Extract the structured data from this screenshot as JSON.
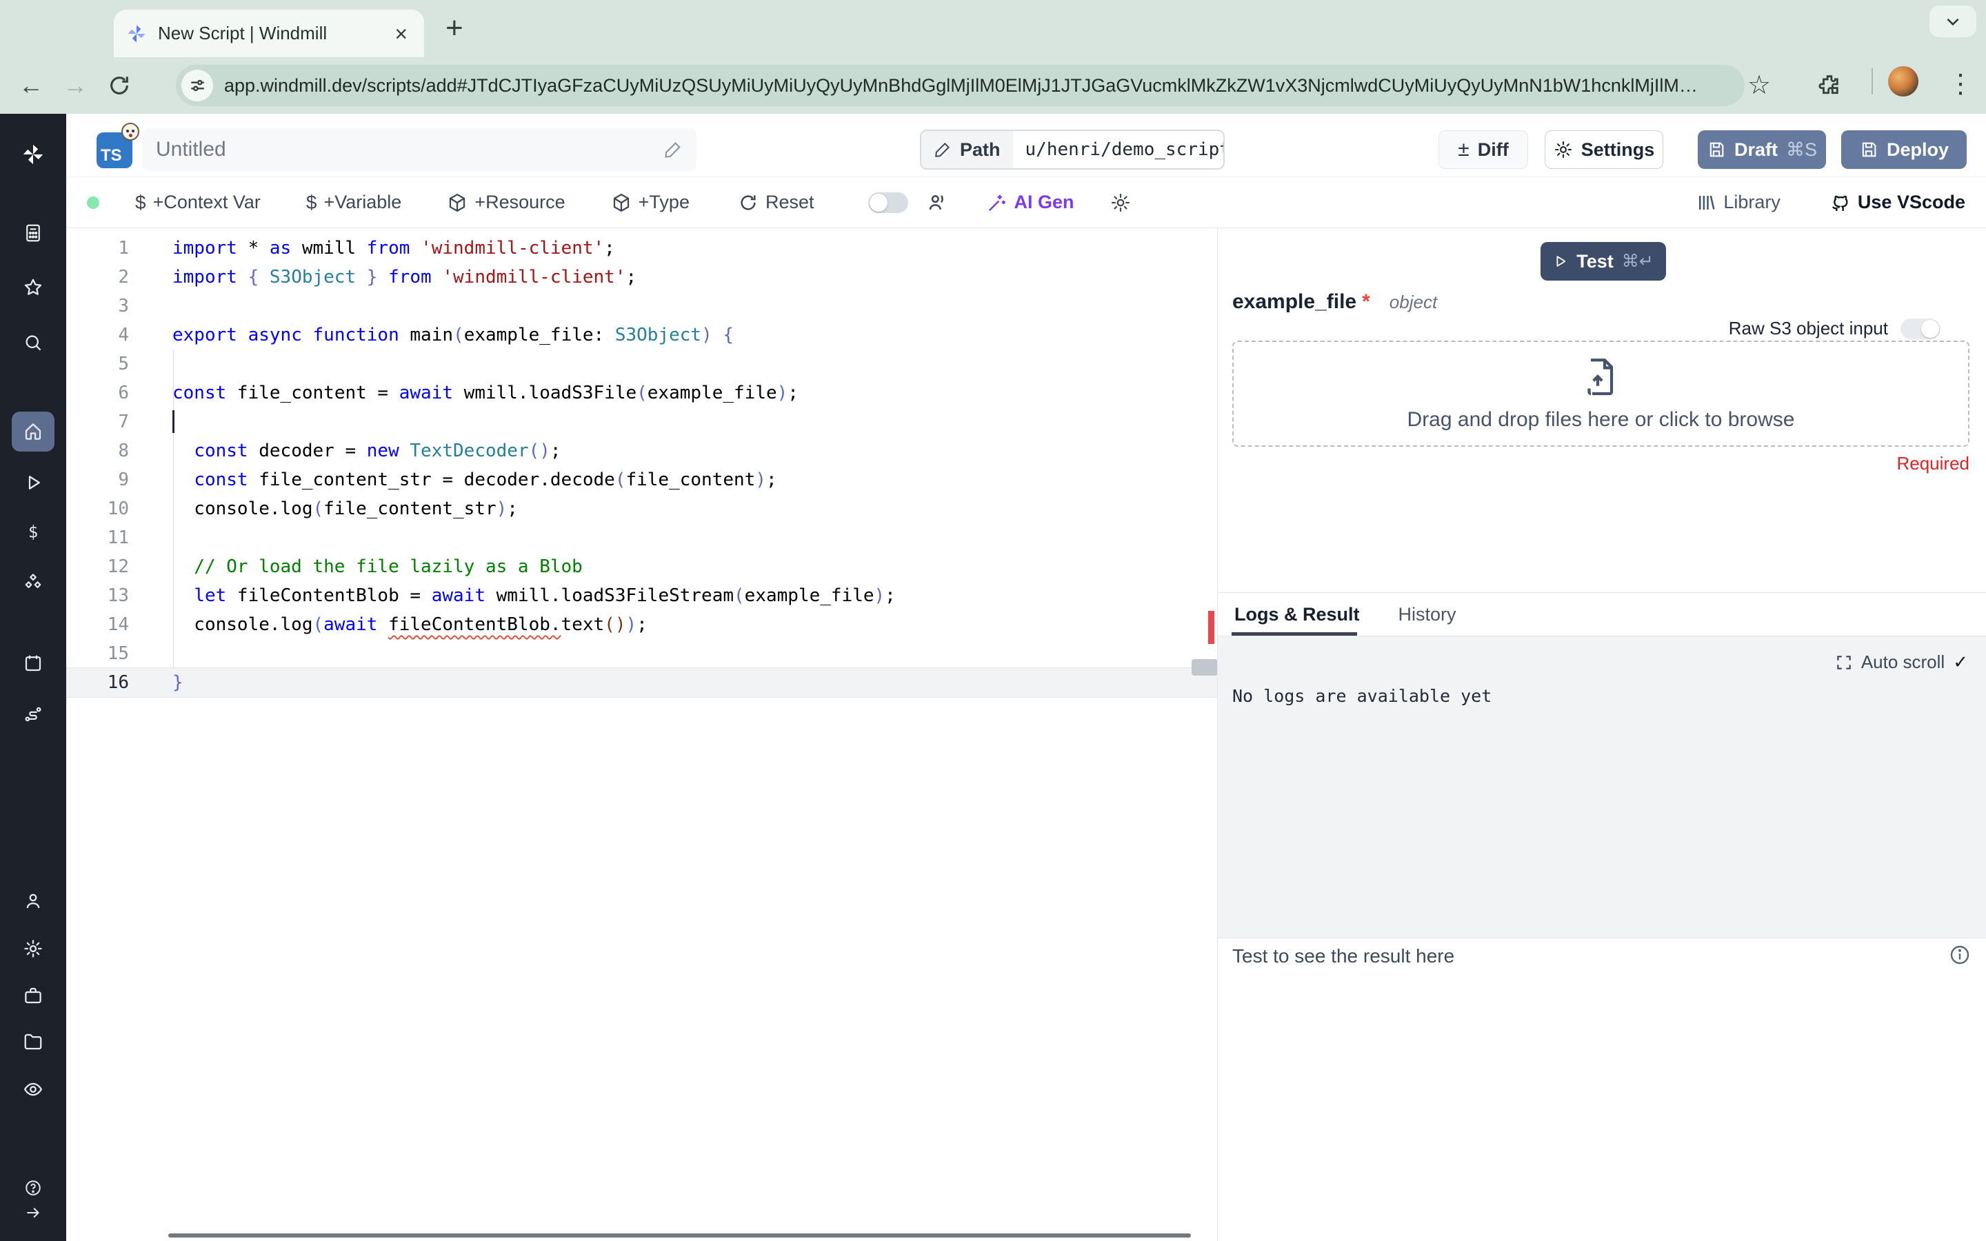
{
  "browser": {
    "tab_title": "New Script | Windmill",
    "close_tab_label": "×",
    "new_tab_label": "+",
    "back_label": "←",
    "forward_label": "→",
    "url": "app.windmill.dev/scripts/add#JTdCJTIyaGFzaCUyMiUzQSUyMiUyMiUyQyUyMnBhdGglMjIlM0ElMjJ1JTJGaGVucmklMkZkZW1vX3NjcmlwdCUyMiUyQyUyMnN1bW1hcnklMjIlM0ElMjIlMjIlMkMlMjJjb250ZW50JTIy",
    "menu_dots": "⋮",
    "bookmark_star": "☆"
  },
  "header": {
    "file_icon_label": "TS",
    "script_name": "Untitled",
    "path_label": "Path",
    "path_value": "u/henri/demo_script",
    "diff_label": "Diff",
    "diff_plusminus": "±",
    "settings_label": "Settings",
    "draft_label": "Draft",
    "draft_shortcut": "⌘S",
    "deploy_label": "Deploy"
  },
  "toolbar": {
    "context_var_label": "+Context Var",
    "variable_label": "+Variable",
    "resource_label": "+Resource",
    "type_label": "+Type",
    "reset_label": "Reset",
    "ai_gen_label": "AI Gen",
    "library_label": "Library",
    "vscode_label": "Use VScode",
    "dollar_glyph": "$"
  },
  "sidebar": {
    "icons_top": [
      "windmill-logo",
      "apps",
      "star",
      "search"
    ],
    "icons_mid": [
      "home",
      "runs",
      "variables",
      "resources",
      "schedules",
      "flows"
    ],
    "active_item": "home",
    "icons_bottom": [
      "user",
      "settings",
      "workers",
      "folders",
      "audit-logs"
    ],
    "icons_footer": [
      "help",
      "collapse-arrow"
    ]
  },
  "editor": {
    "lines": [
      {
        "n": 1,
        "tokens": [
          [
            "k",
            "import"
          ],
          [
            "p",
            " * "
          ],
          [
            "k",
            "as"
          ],
          [
            "p",
            " wmill "
          ],
          [
            "k",
            "from"
          ],
          [
            "p",
            " "
          ],
          [
            "s",
            "'windmill-client'"
          ],
          [
            "p",
            ";"
          ]
        ]
      },
      {
        "n": 2,
        "tokens": [
          [
            "k",
            "import"
          ],
          [
            "p",
            " "
          ],
          [
            "b",
            "{"
          ],
          [
            "p",
            " "
          ],
          [
            "t",
            "S3Object"
          ],
          [
            "p",
            " "
          ],
          [
            "b",
            "}"
          ],
          [
            "p",
            " "
          ],
          [
            "k",
            "from"
          ],
          [
            "p",
            " "
          ],
          [
            "s",
            "'windmill-client'"
          ],
          [
            "p",
            ";"
          ]
        ]
      },
      {
        "n": 3,
        "tokens": []
      },
      {
        "n": 4,
        "tokens": [
          [
            "k",
            "export"
          ],
          [
            "p",
            " "
          ],
          [
            "k",
            "async"
          ],
          [
            "p",
            " "
          ],
          [
            "k",
            "function"
          ],
          [
            "p",
            " main"
          ],
          [
            "b",
            "("
          ],
          [
            "p",
            "example_file: "
          ],
          [
            "t",
            "S3Object"
          ],
          [
            "b",
            ")"
          ],
          [
            "p",
            " "
          ],
          [
            "b",
            "{"
          ]
        ]
      },
      {
        "n": 5,
        "tokens": []
      },
      {
        "n": 6,
        "tokens": [
          [
            "k",
            "const"
          ],
          [
            "p",
            " file_content = "
          ],
          [
            "k",
            "await"
          ],
          [
            "p",
            " wmill.loadS3File"
          ],
          [
            "b",
            "("
          ],
          [
            "p",
            "example_file"
          ],
          [
            "b",
            ")"
          ],
          [
            "p",
            ";"
          ]
        ]
      },
      {
        "n": 7,
        "tokens": [],
        "caret": true
      },
      {
        "n": 8,
        "tokens": [
          [
            "p",
            "  "
          ],
          [
            "k",
            "const"
          ],
          [
            "p",
            " decoder = "
          ],
          [
            "k",
            "new"
          ],
          [
            "p",
            " "
          ],
          [
            "t",
            "TextDecoder"
          ],
          [
            "b",
            "("
          ],
          [
            "b",
            ")"
          ],
          [
            "p",
            ";"
          ]
        ]
      },
      {
        "n": 9,
        "tokens": [
          [
            "p",
            "  "
          ],
          [
            "k",
            "const"
          ],
          [
            "p",
            " file_content_str = decoder.decode"
          ],
          [
            "b",
            "("
          ],
          [
            "p",
            "file_content"
          ],
          [
            "b",
            ")"
          ],
          [
            "p",
            ";"
          ]
        ]
      },
      {
        "n": 10,
        "tokens": [
          [
            "p",
            "  console.log"
          ],
          [
            "b",
            "("
          ],
          [
            "p",
            "file_content_str"
          ],
          [
            "b",
            ")"
          ],
          [
            "p",
            ";"
          ]
        ]
      },
      {
        "n": 11,
        "tokens": []
      },
      {
        "n": 12,
        "tokens": [
          [
            "c",
            "  // Or load the file lazily as a Blob"
          ]
        ]
      },
      {
        "n": 13,
        "tokens": [
          [
            "p",
            "  "
          ],
          [
            "k",
            "let"
          ],
          [
            "p",
            " fileContentBlob = "
          ],
          [
            "k",
            "await"
          ],
          [
            "p",
            " wmill.loadS3FileStream"
          ],
          [
            "b",
            "("
          ],
          [
            "p",
            "example_file"
          ],
          [
            "b",
            ")"
          ],
          [
            "p",
            ";"
          ]
        ]
      },
      {
        "n": 14,
        "tokens": [
          [
            "p",
            "  console.log"
          ],
          [
            "b",
            "("
          ],
          [
            "k",
            "await"
          ],
          [
            "p",
            " "
          ],
          [
            "sq",
            "fileContentBlob."
          ],
          [
            "p",
            "text"
          ],
          [
            "b3",
            "("
          ],
          [
            "b3",
            ")"
          ],
          [
            "b",
            ")"
          ],
          [
            "p",
            ";"
          ]
        ]
      },
      {
        "n": 15,
        "tokens": []
      },
      {
        "n": 16,
        "tokens": [
          [
            "b",
            "}"
          ]
        ],
        "active": true
      }
    ]
  },
  "right_panel": {
    "test_label": "Test",
    "test_shortcut": "⌘↵",
    "param_name": "example_file",
    "param_required_star": "*",
    "param_type": "object",
    "raw_s3_label": "Raw S3 object input",
    "dropzone_text": "Drag and drop files here or click to browse",
    "required_label": "Required",
    "tabs": {
      "logs": "Logs & Result",
      "history": "History"
    },
    "autoscroll_label": "Auto scroll",
    "autoscroll_check": "✓",
    "no_logs_text": "No logs are available yet",
    "result_placeholder": "Test to see the result here"
  },
  "colors": {
    "chrome_bg": "#d8e5df",
    "sidebar_bg": "#1d212a",
    "sidebar_active": "#5d6d90",
    "primary_button": "#657a9e",
    "test_button": "#3d4c69",
    "ai_gen_purple": "#7c3aed",
    "required_red": "#dc2626",
    "status_green": "#86e8ac",
    "keyword_blue": "#0000ff",
    "string_red": "#a31515",
    "type_teal": "#267f99",
    "comment_green": "#008000"
  }
}
